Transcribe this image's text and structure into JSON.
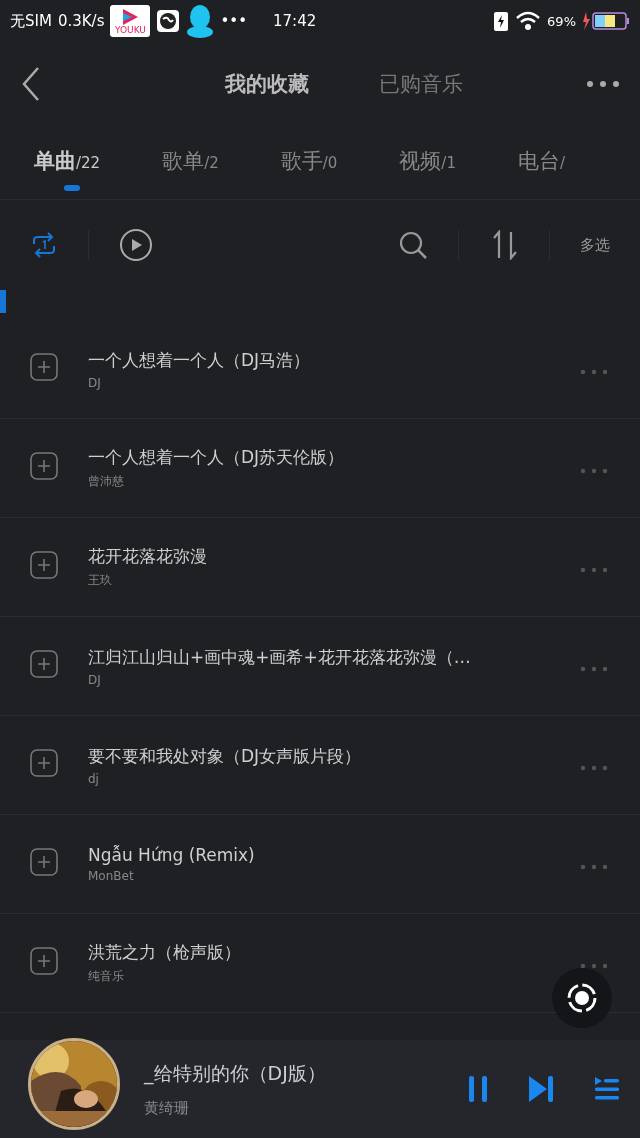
{
  "status_bar": {
    "carrier": "无SIM",
    "speed": "0.3K/s",
    "youku_label": "YOUKU",
    "more": "•••",
    "time": "17:42",
    "battery_percent": "69%"
  },
  "header": {
    "tabs": [
      {
        "label": "我的收藏",
        "selected": true
      },
      {
        "label": "已购音乐",
        "selected": false
      }
    ]
  },
  "category_tabs": [
    {
      "label": "单曲",
      "count": "/22",
      "selected": true
    },
    {
      "label": "歌单",
      "count": "/2",
      "selected": false
    },
    {
      "label": "歌手",
      "count": "/0",
      "selected": false
    },
    {
      "label": "视频",
      "count": "/1",
      "selected": false
    },
    {
      "label": "电台",
      "count": "/",
      "selected": false
    }
  ],
  "toolbar": {
    "multi_select": "多选"
  },
  "songs": [
    {
      "title": "一个人想着一个人（DJ马浩）",
      "artist": "DJ"
    },
    {
      "title": "一个人想着一个人（DJ苏天伦版）",
      "artist": "曾沛慈"
    },
    {
      "title": "花开花落花弥漫",
      "artist": "王玖"
    },
    {
      "title": "江归江山归山+画中魂+画希+花开花落花弥漫（…",
      "artist": "DJ"
    },
    {
      "title": "要不要和我处对象（DJ女声版片段）",
      "artist": "dj"
    },
    {
      "title": "Ngẫu Hứng (Remix)",
      "artist": "MonBet"
    },
    {
      "title": "洪荒之力（枪声版）",
      "artist": "纯音乐"
    }
  ],
  "player": {
    "title": "_给特别的你（DJ版）",
    "artist": "黄绮珊",
    "playing": true
  }
}
